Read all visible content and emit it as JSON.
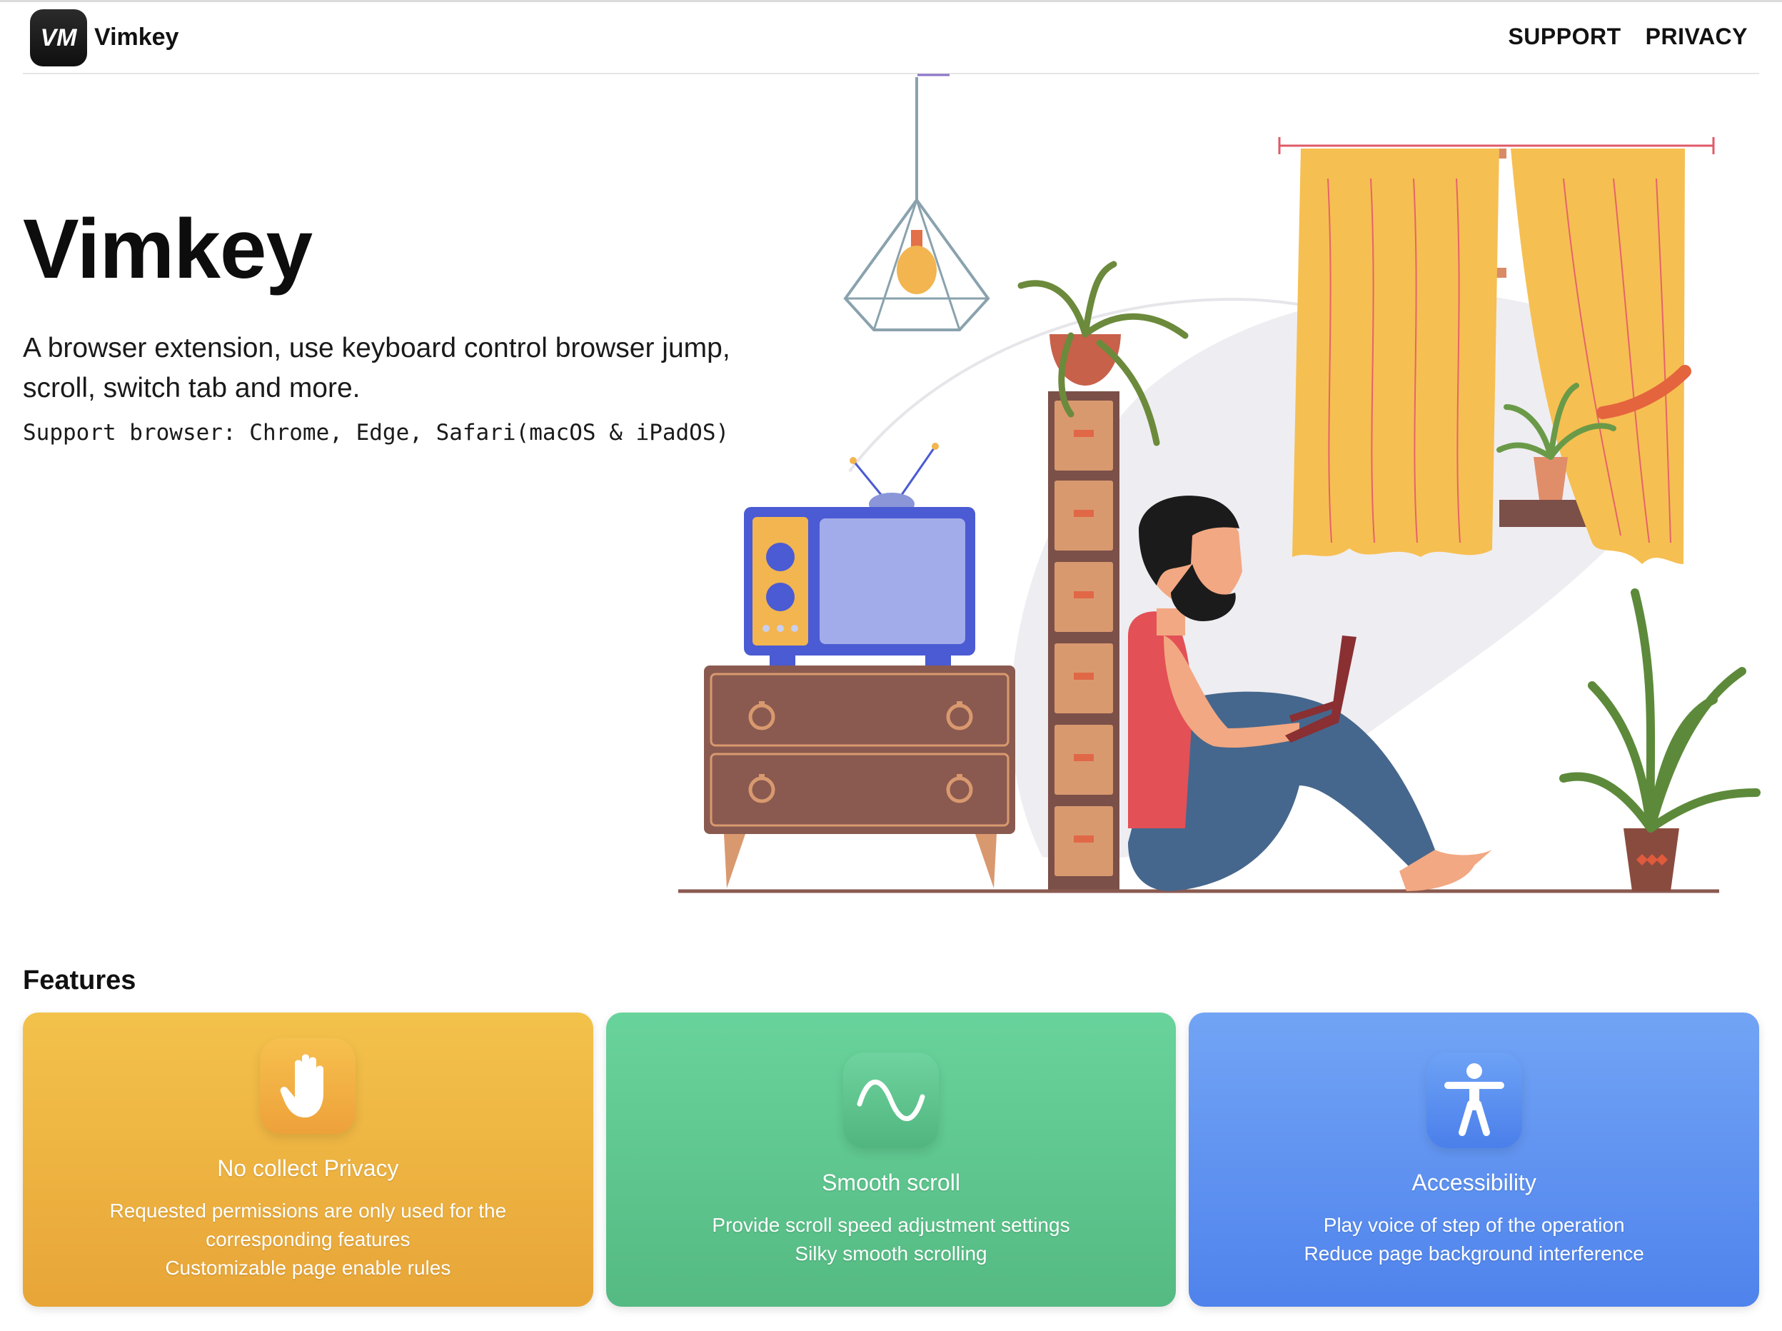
{
  "header": {
    "logo_text": "VM",
    "brand": "Vimkey",
    "nav": [
      {
        "label": "SUPPORT"
      },
      {
        "label": "PRIVACY"
      }
    ]
  },
  "hero": {
    "title": "Vimkey",
    "description": "A browser extension, use keyboard control browser jump, scroll, switch tab and more.",
    "browsers": "Support browser: Chrome, Edge, Safari(macOS & iPadOS)",
    "illustration": "person-with-laptop-in-living-room"
  },
  "features": {
    "heading": "Features",
    "cards": [
      {
        "icon": "hand-raised-icon",
        "title": "No collect Privacy",
        "lines": [
          "Requested permissions are only used for the",
          "corresponding features",
          "Customizable page enable rules"
        ],
        "color": "#eeb23f"
      },
      {
        "icon": "wave-icon",
        "title": "Smooth scroll",
        "lines": [
          "Provide scroll speed adjustment settings",
          "Silky smooth scrolling"
        ],
        "color": "#5ec690"
      },
      {
        "icon": "accessibility-icon",
        "title": "Accessibility",
        "lines": [
          "Play voice of step of the operation",
          "Reduce page background interference"
        ],
        "color": "#5f92f1"
      }
    ]
  }
}
